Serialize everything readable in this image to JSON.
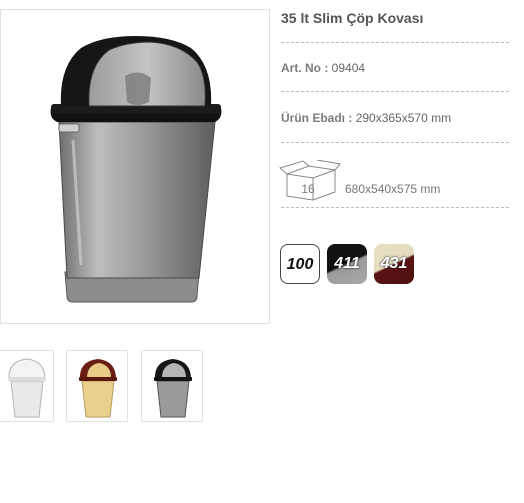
{
  "product": {
    "title": "35 lt Slim Çöp Kovası",
    "art_label": "Art. No :",
    "art_value": "09404",
    "size_label": "Ürün Ebadı :",
    "size_value": "290x365x570 mm",
    "box_count": "16",
    "box_dims": "680x540x575 mm"
  },
  "colors": [
    {
      "code": "100",
      "swatch": "white"
    },
    {
      "code": "411",
      "swatch": "black/grey"
    },
    {
      "code": "431",
      "swatch": "cream/brown"
    }
  ],
  "thumbnails": [
    {
      "variant": "white"
    },
    {
      "variant": "brown-cream"
    },
    {
      "variant": "black-grey"
    }
  ],
  "icons": {
    "box": "box-icon",
    "bin": "trash-bin-image"
  }
}
